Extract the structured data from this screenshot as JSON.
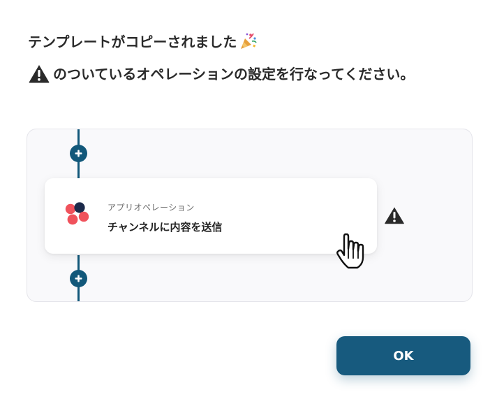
{
  "dialog": {
    "title": "テンプレートがコピーされました",
    "title_icon": "party-popper-icon",
    "instruction": "のついているオペレーションの設定を行なってください。",
    "instruction_icon": "warning-icon"
  },
  "flow": {
    "operation": {
      "type_label": "アプリオペレーション",
      "name": "チャンネルに内容を送信",
      "app_icon": "asana-logo-icon",
      "status_icon": "warning-icon"
    },
    "add_step_icon": "plus-icon",
    "line_color": "#12587a"
  },
  "actions": {
    "ok_label": "OK",
    "ok_color": "#175a7e"
  },
  "cursor": "hand-pointer-icon"
}
